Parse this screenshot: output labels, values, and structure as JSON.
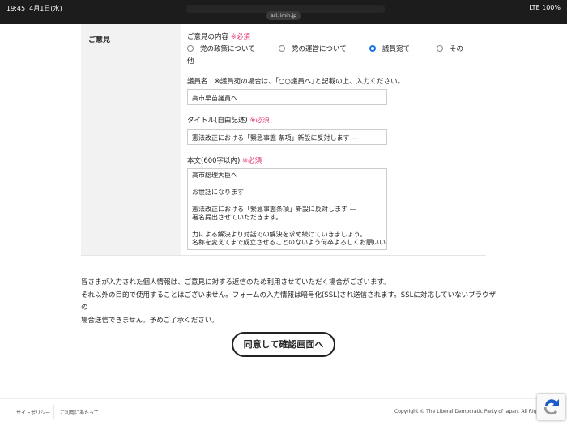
{
  "status": {
    "time": "19:45",
    "date": "4月1日(水)",
    "url": "ssl.jimin.jp",
    "signal": "LTE 100%"
  },
  "form": {
    "section_label": "ご意見",
    "content_label": "ご意見の内容",
    "required": "※必須",
    "radios": [
      {
        "label": "党の政策について",
        "checked": false
      },
      {
        "label": "党の運営について",
        "checked": false
      },
      {
        "label": "議員宛て",
        "checked": true
      },
      {
        "label": "その",
        "checked": false
      }
    ],
    "radio_wrap": "他",
    "member_label": "議員名",
    "member_note": "※議員宛の場合は、｢○○議員へ｣と記載の上、入力ください。",
    "member_value": "高市早苗議員へ",
    "title_label": "タイトル(自由記述)",
    "title_value": "憲法改正における「緊急事態 条項」新設に反対します —",
    "body_label": "本文(600字以内)",
    "body_lines": [
      "高市総理大臣へ",
      "",
      "お世話になります",
      "",
      "憲法改正における「緊急事態条項」新設に反対します —",
      "署名提出させていただきます。",
      "",
      "力による解決より対話での解決を求め続けていきましょう。",
      "名称を変えてまで成立させることのないよう何卒よろしくお願いい"
    ]
  },
  "notice": [
    "皆さまが入力された個人情報は、ご意見に対する返信のため利用させていただく場合がございます。",
    "それ以外の目的で使用することはございません。フォームの入力情報は暗号化(SSL)され送信されます。SSLに対応していないブラウザの",
    "場合送信できません。予めご了承ください。"
  ],
  "submit_label": "同意して確認画面へ",
  "footer": {
    "links": [
      "サイトポリシー",
      "ご利用にあたって"
    ],
    "copyright": "Copyright © The Liberal Democratic Party of Japan. All Rights Re"
  }
}
